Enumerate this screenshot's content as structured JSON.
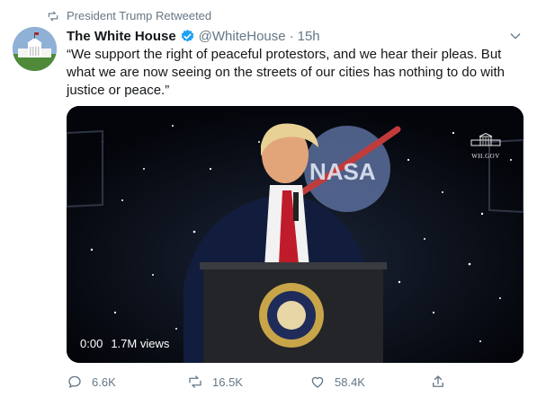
{
  "retweet_context": {
    "text": "President Trump Retweeted",
    "icon": "retweet-icon"
  },
  "author": {
    "display_name": "The White House",
    "handle": "@WhiteHouse",
    "separator": "·",
    "timestamp": "15h",
    "verified": true,
    "avatar_icon": "white-house-avatar"
  },
  "tweet": {
    "text": "“We support the right of peaceful protestors, and we hear their pleas. But what we are now seeing on the streets of our cities has nothing to do with justice or peace.”"
  },
  "media": {
    "type": "video",
    "watermark": "WH.GOV",
    "elapsed": "0:00",
    "views": "1.7M views",
    "background_text": "NASA"
  },
  "actions": {
    "reply": {
      "icon": "reply-icon",
      "count": "6.6K"
    },
    "retweet": {
      "icon": "retweet-icon",
      "count": "16.5K"
    },
    "like": {
      "icon": "heart-icon",
      "count": "58.4K"
    },
    "share": {
      "icon": "share-icon"
    }
  },
  "colors": {
    "text_primary": "#14171a",
    "text_secondary": "#657786",
    "verified_blue": "#1da1f2",
    "media_background": "#05070d"
  }
}
